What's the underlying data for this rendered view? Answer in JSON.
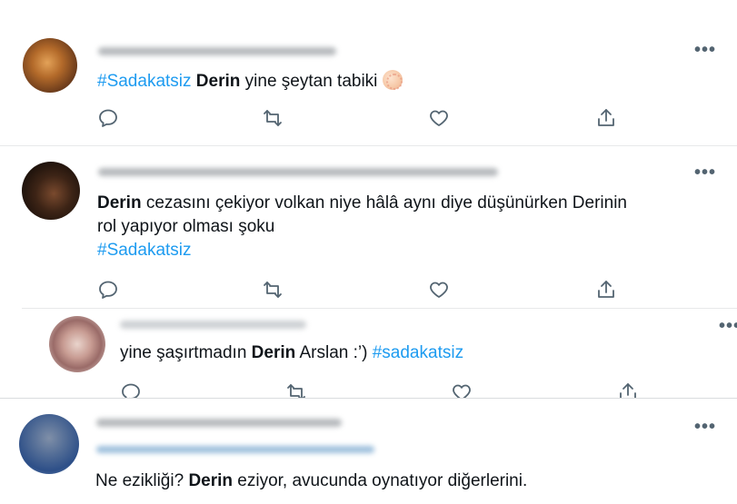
{
  "tweets": [
    {
      "segments": [
        {
          "t": "#Sadakatsiz",
          "style": "tag"
        },
        {
          "t": " ",
          "style": "plain"
        },
        {
          "t": "Derin",
          "style": "bold"
        },
        {
          "t": " yine şeytan tabiki ",
          "style": "plain"
        }
      ],
      "more": "•••"
    },
    {
      "line1": [
        {
          "t": "Derin",
          "style": "bold"
        },
        {
          "t": " cezasını çekiyor volkan niye hâlâ aynı diye düşünürken Derinin",
          "style": "plain"
        }
      ],
      "line2": "rol yapıyor olması şoku",
      "hashtag": "#Sadakatsiz",
      "more": "•••"
    },
    {
      "segments": [
        {
          "t": "yine şaşırtmadın ",
          "style": "plain"
        },
        {
          "t": "Derin",
          "style": "bold"
        },
        {
          "t": " Arslan :’) ",
          "style": "plain"
        },
        {
          "t": "#sadakatsiz",
          "style": "tag"
        }
      ],
      "more": "•••"
    },
    {
      "segments": [
        {
          "t": "Ne ezikliği? ",
          "style": "plain"
        },
        {
          "t": "Derin",
          "style": "bold"
        },
        {
          "t": " eziyor, avucunda oynatıyor diğerlerini.",
          "style": "plain"
        }
      ],
      "more": "•••"
    }
  ],
  "icons": [
    "reply-icon",
    "retweet-icon",
    "like-icon",
    "share-icon",
    "more-icon",
    "clapping-hands-emoji"
  ],
  "colors": {
    "hashtag": "#1d9bf0",
    "icon": "#536471",
    "text": "#0f1419",
    "divider": "#e7e9ea"
  }
}
